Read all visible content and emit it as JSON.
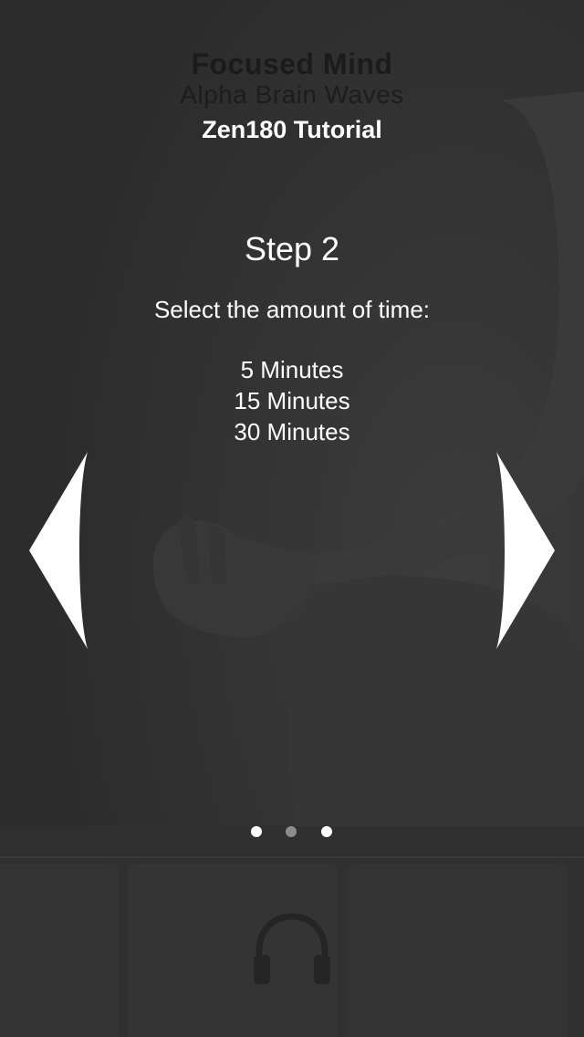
{
  "header": {
    "app_title": "Focused Mind",
    "app_subtitle": "Alpha Brain Waves",
    "tutorial_title": "Zen180 Tutorial"
  },
  "step": {
    "title": "Step 2",
    "instruction": "Select the amount of time:",
    "options": [
      "5 Minutes",
      "15 Minutes",
      "30 Minutes"
    ]
  },
  "navigation": {
    "left_icon": "chevron-left-icon",
    "right_icon": "chevron-right-icon"
  },
  "pager": {
    "page_count": 3,
    "current_page": 2
  },
  "bottom": {
    "icon": "headphones-icon"
  },
  "colors": {
    "overlay": "#2e2e2e",
    "text": "#ffffff",
    "dot_active": "#8c8c8c",
    "dot_inactive": "#ffffff"
  }
}
